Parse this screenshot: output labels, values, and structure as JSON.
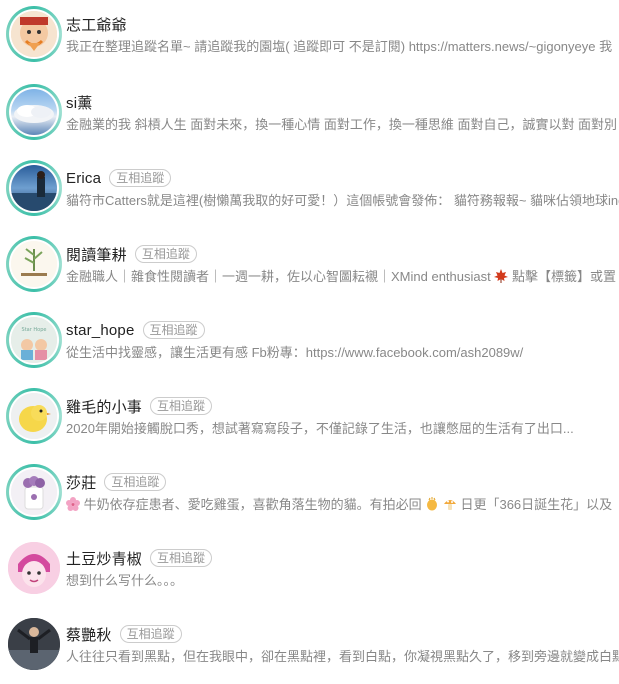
{
  "mutual_follow_label": "互相追蹤",
  "users": [
    {
      "name": "志工爺爺",
      "mutual": false,
      "desc": "我正在整理追蹤名單~ 請追蹤我的園塩( 追蹤即可 不是訂閱) https://matters.news/~gigonyeye 我"
    },
    {
      "name": "si薰",
      "mutual": false,
      "desc": "金融業的我 斜槓人生 面對未來，換一種心情 面對工作，換一種思維 面對自己，誠實以對 面對別"
    },
    {
      "name": "Erica",
      "mutual": true,
      "desc": "貓符市Catters就是這裡(樹懶萬我取的好可愛！）這個帳號會發佈： 貓符務報報~ 貓咪佔領地球ing"
    },
    {
      "name": "閱讀筆耕",
      "mutual": true,
      "desc_before": "金融職人｜雜食性閱讀者｜一週一耕，佐以心智圖耘襯｜XMind enthusiast ",
      "desc_after": " 點擊【標籤】或置"
    },
    {
      "name": "star_hope",
      "mutual": true,
      "desc": "從生活中找靈感，讓生活更有感 Fb粉專：https://www.facebook.com/ash2089w/"
    },
    {
      "name": "雞毛的小事",
      "mutual": true,
      "desc": "2020年開始接觸脫口秀，想試著寫寫段子，不僅記錄了生活，也讓憋屈的生活有了出口..."
    },
    {
      "name": "莎莊",
      "mutual": true,
      "desc_a": " 牛奶依存症患者、愛吃雞蛋，喜歡角落生物的貓。有拍必回 ",
      "desc_b": " 日更「366日誕生花」以及"
    },
    {
      "name": "土豆炒青椒",
      "mutual": true,
      "desc": "想到什么写什么。。。"
    },
    {
      "name": "蔡艷秋",
      "mutual": true,
      "desc": "人往往只看到黑點，但在我眼中，卻在黑點裡，看到白點，你凝視黑點久了，移到旁邊就變成白點"
    }
  ]
}
